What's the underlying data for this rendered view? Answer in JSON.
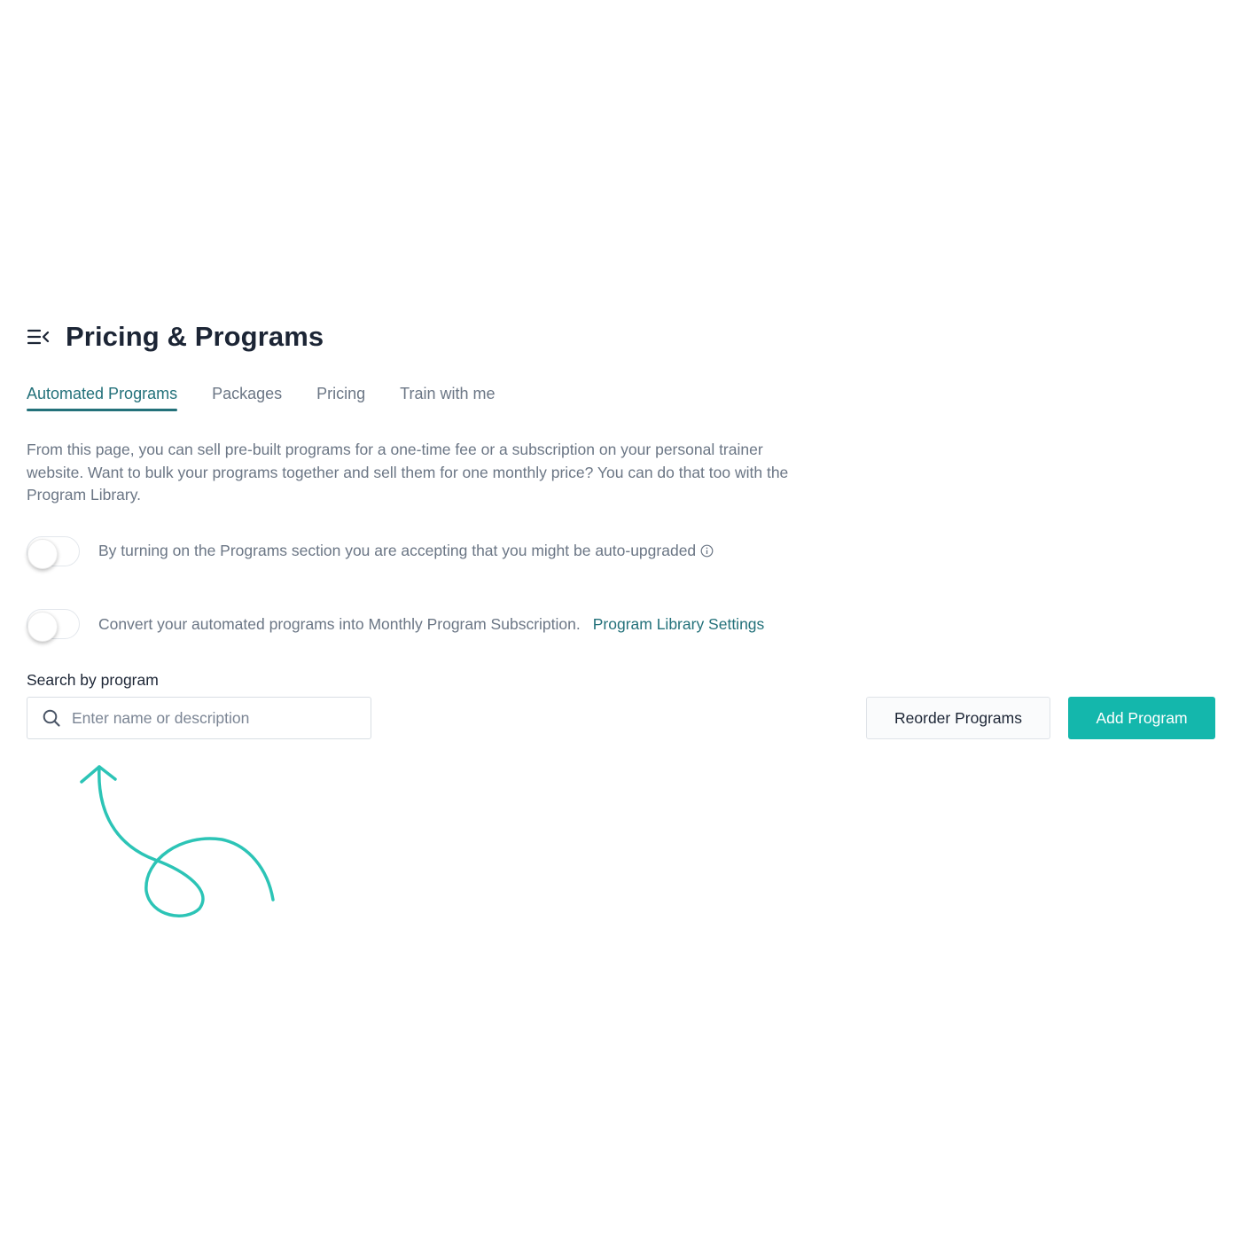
{
  "header": {
    "title": "Pricing & Programs",
    "menu_icon": "menu-collapse-icon"
  },
  "tabs": [
    {
      "label": "Automated Programs",
      "active": true
    },
    {
      "label": "Packages",
      "active": false
    },
    {
      "label": "Pricing",
      "active": false
    },
    {
      "label": "Train with me",
      "active": false
    }
  ],
  "description": "From this page, you can sell pre-built programs for a one-time fee or a subscription on your personal trainer website. Want to bulk your programs together and sell them for one monthly price? You can do that too with the Program Library.",
  "toggles": [
    {
      "label": "By turning on the Programs section you are accepting that you might be auto-upgraded",
      "on": false,
      "icon": "info-icon"
    },
    {
      "label": "Convert your automated programs into Monthly Program Subscription.",
      "on": false,
      "link": "Program Library Settings"
    }
  ],
  "search": {
    "label": "Search by program",
    "placeholder": "Enter name or description",
    "value": ""
  },
  "buttons": {
    "reorder": "Reorder Programs",
    "add": "Add Program"
  },
  "colors": {
    "accent": "#14b7ac",
    "link": "#23717a",
    "title": "#1c2535",
    "text": "#6b7685",
    "doodle": "#2cc4b6"
  }
}
